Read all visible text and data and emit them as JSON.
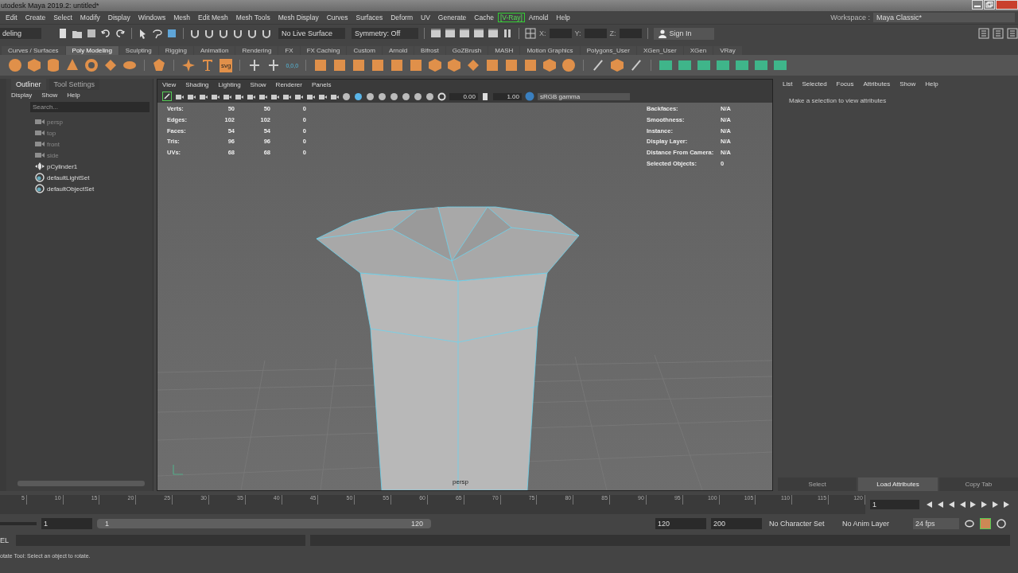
{
  "window": {
    "title": "utodesk Maya 2019.2: untitled*"
  },
  "menu_bar": {
    "items": [
      {
        "label": "Edit",
        "highlighted": false
      },
      {
        "label": "Create",
        "highlighted": false
      },
      {
        "label": "Select",
        "highlighted": false
      },
      {
        "label": "Modify",
        "highlighted": false
      },
      {
        "label": "Display",
        "highlighted": false
      },
      {
        "label": "Windows",
        "highlighted": false
      },
      {
        "label": "Mesh",
        "highlighted": false
      },
      {
        "label": "Edit Mesh",
        "highlighted": false
      },
      {
        "label": "Mesh Tools",
        "highlighted": false
      },
      {
        "label": "Mesh Display",
        "highlighted": false
      },
      {
        "label": "Curves",
        "highlighted": false
      },
      {
        "label": "Surfaces",
        "highlighted": false
      },
      {
        "label": "Deform",
        "highlighted": false
      },
      {
        "label": "UV",
        "highlighted": false
      },
      {
        "label": "Generate",
        "highlighted": false
      },
      {
        "label": "Cache",
        "highlighted": false
      },
      {
        "label": "[V-Ray]",
        "highlighted": true
      },
      {
        "label": "Arnold",
        "highlighted": false
      },
      {
        "label": "Help",
        "highlighted": false
      }
    ],
    "workspace_label": "Workspace :",
    "workspace_value": "Maya Classic*"
  },
  "status_line": {
    "mode": "deling",
    "live_surface": "No Live Surface",
    "symmetry": "Symmetry: Off",
    "coords": [
      "X:",
      "Y:",
      "Z:"
    ],
    "sign_in": "Sign In"
  },
  "shelf": {
    "tabs": [
      {
        "label": "Curves / Surfaces",
        "selected": false
      },
      {
        "label": "Poly Modeling",
        "selected": true
      },
      {
        "label": "Sculpting",
        "selected": false
      },
      {
        "label": "Rigging",
        "selected": false
      },
      {
        "label": "Animation",
        "selected": false
      },
      {
        "label": "Rendering",
        "selected": false
      },
      {
        "label": "FX",
        "selected": false
      },
      {
        "label": "FX Caching",
        "selected": false
      },
      {
        "label": "Custom",
        "selected": false
      },
      {
        "label": "Arnold",
        "selected": false
      },
      {
        "label": "Bifrost",
        "selected": false
      },
      {
        "label": "GoZBrush",
        "selected": false
      },
      {
        "label": "MASH",
        "selected": false
      },
      {
        "label": "Motion Graphics",
        "selected": false
      },
      {
        "label": "Polygons_User",
        "selected": false
      },
      {
        "label": "XGen_User",
        "selected": false
      },
      {
        "label": "XGen",
        "selected": false
      },
      {
        "label": "VRay",
        "selected": false
      }
    ],
    "svg_label": "svg",
    "coords_label": "0,0,0"
  },
  "outliner": {
    "tabs": [
      {
        "label": "Outliner",
        "selected": true
      },
      {
        "label": "Tool Settings",
        "selected": false
      }
    ],
    "menu": [
      "Display",
      "Show",
      "Help"
    ],
    "search": {
      "placeholder": "Search..."
    },
    "items": [
      {
        "label": "persp",
        "kind": "camera",
        "dimmed": true
      },
      {
        "label": "top",
        "kind": "camera",
        "dimmed": true
      },
      {
        "label": "front",
        "kind": "camera",
        "dimmed": true
      },
      {
        "label": "side",
        "kind": "camera",
        "dimmed": true
      },
      {
        "label": "pCylinder1",
        "kind": "transform",
        "dimmed": false
      },
      {
        "label": "defaultLightSet",
        "kind": "set",
        "dimmed": false
      },
      {
        "label": "defaultObjectSet",
        "kind": "set",
        "dimmed": false
      }
    ]
  },
  "viewport": {
    "menu": [
      "View",
      "Shading",
      "Lighting",
      "Show",
      "Renderer",
      "Panels"
    ],
    "exposure": "0.00",
    "gamma": "1.00",
    "color_space": "sRGB gamma",
    "hud_left": [
      {
        "label": "Verts:",
        "values": [
          "50",
          "50",
          "0"
        ]
      },
      {
        "label": "Edges:",
        "values": [
          "102",
          "102",
          "0"
        ]
      },
      {
        "label": "Faces:",
        "values": [
          "54",
          "54",
          "0"
        ]
      },
      {
        "label": "Tris:",
        "values": [
          "96",
          "96",
          "0"
        ]
      },
      {
        "label": "UVs:",
        "values": [
          "68",
          "68",
          "0"
        ]
      }
    ],
    "hud_right": [
      {
        "label": "Backfaces:",
        "value": "N/A"
      },
      {
        "label": "Smoothness:",
        "value": "N/A"
      },
      {
        "label": "Instance:",
        "value": "N/A"
      },
      {
        "label": "Display Layer:",
        "value": "N/A"
      },
      {
        "label": "Distance From Camera:",
        "value": "N/A"
      },
      {
        "label": "Selected Objects:",
        "value": "0"
      }
    ],
    "camera_label": "persp"
  },
  "attribute_editor": {
    "menu": [
      "List",
      "Selected",
      "Focus",
      "Attributes",
      "Show",
      "Help"
    ],
    "message": "Make a selection to view attributes",
    "buttons": [
      {
        "label": "Select",
        "disabled": true
      },
      {
        "label": "Load Attributes",
        "disabled": false
      },
      {
        "label": "Copy Tab",
        "disabled": true
      }
    ]
  },
  "time_slider": {
    "ticks": [
      "5",
      "10",
      "15",
      "20",
      "25",
      "30",
      "35",
      "40",
      "45",
      "50",
      "55",
      "60",
      "65",
      "70",
      "75",
      "80",
      "85",
      "90",
      "95",
      "100",
      "105",
      "110",
      "115",
      "120"
    ],
    "current_frame": "1"
  },
  "range_slider": {
    "start": "1",
    "range_start": "1",
    "range_end": "120",
    "end": "120",
    "anim_end": "200",
    "character_set": "No Character Set",
    "anim_layer": "No Anim Layer",
    "fps": "24 fps"
  },
  "command_line": {
    "label": "EL"
  },
  "help_line": "otate Tool: Select an object to rotate."
}
